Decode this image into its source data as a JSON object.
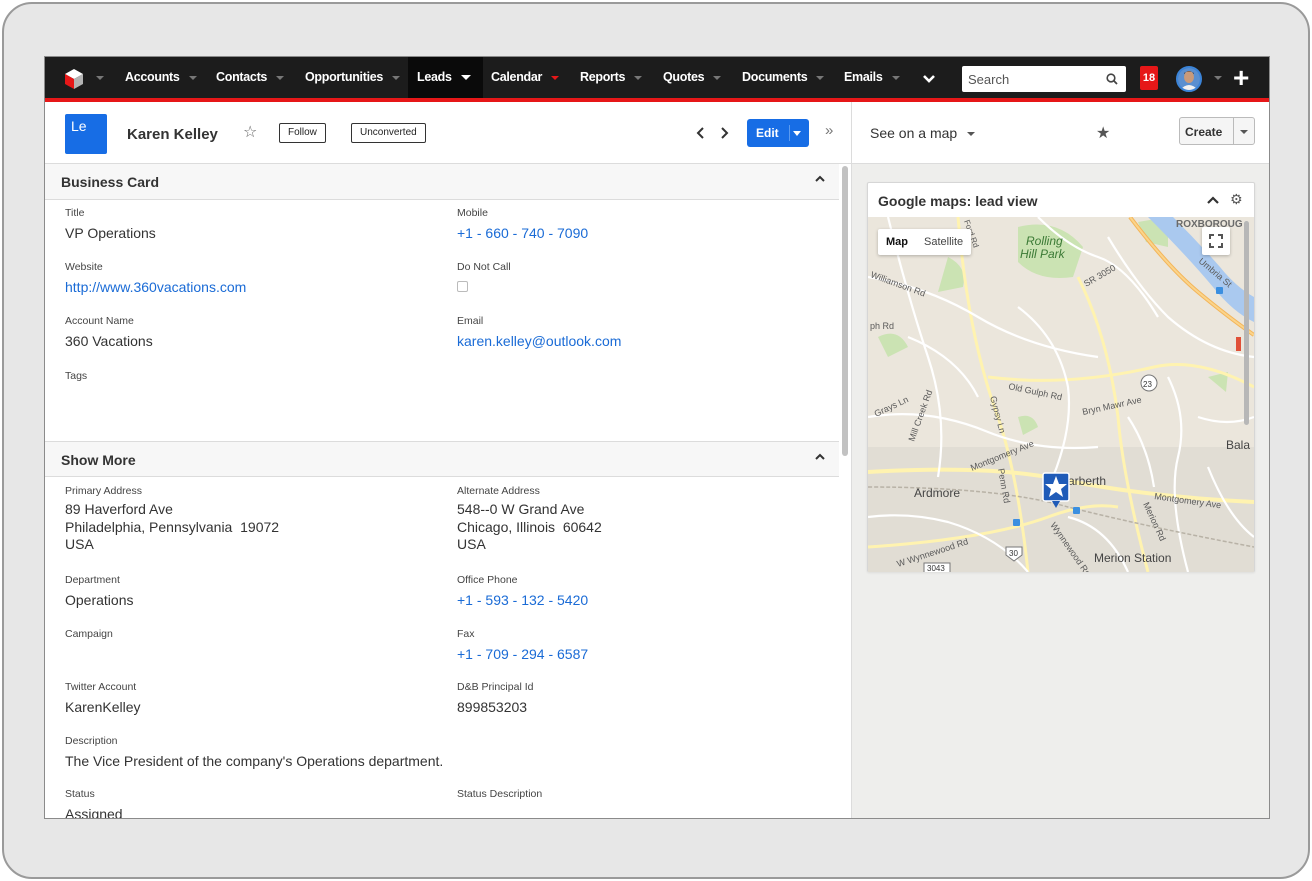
{
  "nav": {
    "items": [
      {
        "label": "Accounts"
      },
      {
        "label": "Contacts"
      },
      {
        "label": "Opportunities"
      },
      {
        "label": "Leads"
      },
      {
        "label": "Calendar"
      },
      {
        "label": "Reports"
      },
      {
        "label": "Quotes"
      },
      {
        "label": "Documents"
      },
      {
        "label": "Emails"
      }
    ],
    "search_placeholder": "Search",
    "notification_count": "18"
  },
  "record": {
    "badge": "Le",
    "name": "Karen Kelley",
    "follow_label": "Follow",
    "status_label": "Unconverted",
    "edit_label": "Edit"
  },
  "panels": {
    "business_card": {
      "title": "Business Card",
      "fields": {
        "title": {
          "label": "Title",
          "value": "VP Operations"
        },
        "mobile": {
          "label": "Mobile",
          "value": "+1 - 660 - 740 - 7090"
        },
        "website": {
          "label": "Website",
          "value": "http://www.360vacations.com"
        },
        "do_not_call": {
          "label": "Do Not Call",
          "checked": false
        },
        "account_name": {
          "label": "Account Name",
          "value": "360 Vacations"
        },
        "email": {
          "label": "Email",
          "value": "karen.kelley@outlook.com"
        },
        "tags": {
          "label": "Tags",
          "value": ""
        }
      }
    },
    "show_more": {
      "title": "Show More",
      "fields": {
        "primary_address": {
          "label": "Primary Address",
          "line1": "89 Haverford Ave",
          "line2": "Philadelphia, Pennsylvania  19072",
          "line3": "USA"
        },
        "alternate_address": {
          "label": "Alternate Address",
          "line1": "548--0 W Grand Ave",
          "line2": "Chicago, Illinois  60642",
          "line3": "USA"
        },
        "department": {
          "label": "Department",
          "value": "Operations"
        },
        "office_phone": {
          "label": "Office Phone",
          "value": "+1 - 593 - 132 - 5420"
        },
        "campaign": {
          "label": "Campaign",
          "value": ""
        },
        "fax": {
          "label": "Fax",
          "value": "+1 - 709 - 294 - 6587"
        },
        "twitter": {
          "label": "Twitter Account",
          "value": "KarenKelley"
        },
        "dnb": {
          "label": "D&B Principal Id",
          "value": "899853203"
        },
        "description": {
          "label": "Description",
          "value": "The Vice President of the company's Operations department."
        },
        "status": {
          "label": "Status",
          "value": "Assigned"
        },
        "status_description": {
          "label": "Status Description",
          "value": ""
        }
      }
    }
  },
  "sidebar": {
    "see_on_map": "See on a map",
    "create_label": "Create",
    "dashlet_title": "Google maps: lead view",
    "map_type": {
      "map": "Map",
      "satellite": "Satellite"
    },
    "map_labels": {
      "roxborough": "ROXBOROUG",
      "rolling_hill_1": "Rolling",
      "rolling_hill_2": "Hill Park",
      "williamson": "Williamson Rd",
      "sr3050": "SR 3050",
      "old_gulph": "Old Gulph Rd",
      "bryn_mawr": "Bryn Mawr Ave",
      "grays": "Grays Ln",
      "mill_creek": "Mill Creek Rd",
      "gypsy": "Gypsy Ln",
      "montgomery": "Montgomery Ave",
      "montgomery2": "Montgomery Ave",
      "bala": "Bala",
      "ardmore": "Ardmore",
      "narberth": "arberth",
      "penn": "Penn Rd",
      "merion_rd": "Merion Rd",
      "wynnewood": "W Wynnewood Rd",
      "wynnewood2": "Wynnewood Rd",
      "merion_station": "Merion Station",
      "r23": "23",
      "r30": "30",
      "r3043": "3043",
      "fordrd": "Ford Rd",
      "umbria": "Umbria St",
      "phrd": "ph Rd"
    },
    "colors": {
      "accent": "#e61718",
      "primary": "#176de5",
      "link": "#1a6bd6",
      "map_marker": "#1f5bb8"
    }
  }
}
